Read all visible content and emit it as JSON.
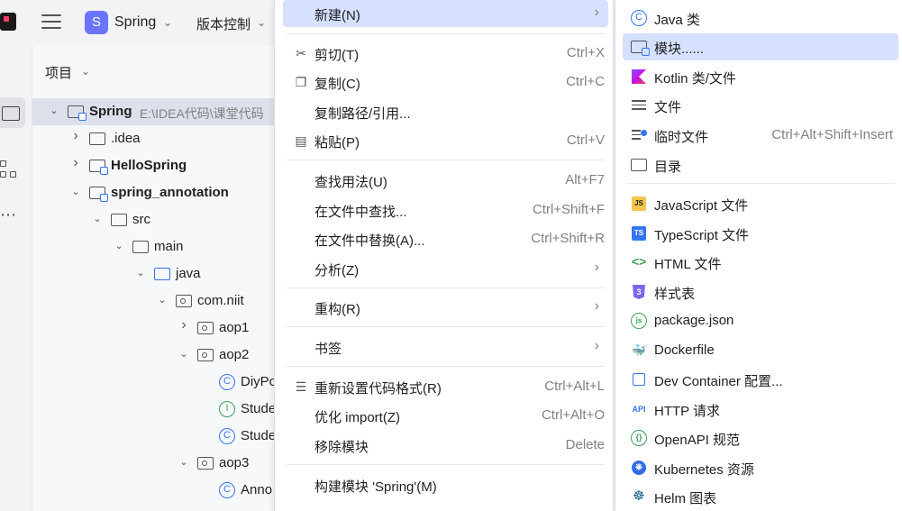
{
  "topbar": {
    "project_badge": "S",
    "project_name": "Spring",
    "vcs_label": "版本控制"
  },
  "panel": {
    "title": "项目",
    "tree": [
      {
        "label": "Spring",
        "path": "E:\\IDEA代码\\课堂代码",
        "icon": "module",
        "bold": true,
        "arrow": "down",
        "selected": true
      },
      {
        "label": ".idea",
        "icon": "folder",
        "arrow": "right"
      },
      {
        "label": "HelloSpring",
        "icon": "module",
        "bold": true,
        "arrow": "right"
      },
      {
        "label": "spring_annotation",
        "icon": "module",
        "bold": true,
        "arrow": "down"
      },
      {
        "label": "src",
        "icon": "folder",
        "arrow": "down"
      },
      {
        "label": "main",
        "icon": "folder",
        "arrow": "down"
      },
      {
        "label": "java",
        "icon": "folder-blue",
        "arrow": "down"
      },
      {
        "label": "com.niit",
        "icon": "package",
        "arrow": "down"
      },
      {
        "label": "aop1",
        "icon": "package",
        "arrow": "right"
      },
      {
        "label": "aop2",
        "icon": "package",
        "arrow": "down"
      },
      {
        "label": "DiyPo",
        "icon": "class",
        "arrow": ""
      },
      {
        "label": "Stude",
        "icon": "interface",
        "arrow": ""
      },
      {
        "label": "Stude",
        "icon": "class",
        "arrow": ""
      },
      {
        "label": "aop3",
        "icon": "package",
        "arrow": "down"
      },
      {
        "label": "Anno",
        "icon": "class",
        "arrow": ""
      }
    ]
  },
  "context_menu": {
    "items": [
      {
        "label": "新建(N)",
        "shortcut": "",
        "submenu": true,
        "icon": "",
        "highlighted": true
      },
      {
        "label": "剪切(T)",
        "shortcut": "Ctrl+X",
        "icon": "scissors-icon"
      },
      {
        "label": "复制(C)",
        "shortcut": "Ctrl+C",
        "icon": "copy-icon"
      },
      {
        "label": "复制路径/引用...",
        "shortcut": "",
        "icon": ""
      },
      {
        "label": "粘贴(P)",
        "shortcut": "Ctrl+V",
        "icon": "paste-icon"
      },
      {
        "label": "查找用法(U)",
        "shortcut": "Alt+F7",
        "icon": ""
      },
      {
        "label": "在文件中查找...",
        "shortcut": "Ctrl+Shift+F",
        "icon": ""
      },
      {
        "label": "在文件中替换(A)...",
        "shortcut": "Ctrl+Shift+R",
        "icon": ""
      },
      {
        "label": "分析(Z)",
        "shortcut": "",
        "submenu": true,
        "icon": ""
      },
      {
        "label": "重构(R)",
        "shortcut": "",
        "submenu": true,
        "icon": ""
      },
      {
        "label": "书签",
        "shortcut": "",
        "submenu": true,
        "icon": ""
      },
      {
        "label": "重新设置代码格式(R)",
        "shortcut": "Ctrl+Alt+L",
        "icon": "reformat-icon"
      },
      {
        "label": "优化 import(Z)",
        "shortcut": "Ctrl+Alt+O",
        "icon": ""
      },
      {
        "label": "移除模块",
        "shortcut": "Delete",
        "icon": ""
      },
      {
        "label": "构建模块 'Spring'(M)",
        "shortcut": "",
        "icon": ""
      }
    ]
  },
  "submenu": {
    "items": [
      {
        "label": "Java 类",
        "shortcut": "",
        "icon": "java-class-icon"
      },
      {
        "label": "模块......",
        "shortcut": "",
        "icon": "module-icon",
        "highlighted": true
      },
      {
        "label": "Kotlin 类/文件",
        "shortcut": "",
        "icon": "kotlin-icon"
      },
      {
        "label": "文件",
        "shortcut": "",
        "icon": "text-file-icon"
      },
      {
        "label": "临时文件",
        "shortcut": "Ctrl+Alt+Shift+Insert",
        "icon": "scratch-file-icon"
      },
      {
        "label": "目录",
        "shortcut": "",
        "icon": "directory-icon"
      },
      {
        "label": "JavaScript 文件",
        "shortcut": "",
        "icon": "javascript-icon"
      },
      {
        "label": "TypeScript 文件",
        "shortcut": "",
        "icon": "typescript-icon"
      },
      {
        "label": "HTML 文件",
        "shortcut": "",
        "icon": "html-icon"
      },
      {
        "label": "样式表",
        "shortcut": "",
        "icon": "css-icon"
      },
      {
        "label": "package.json",
        "shortcut": "",
        "icon": "nodejs-icon"
      },
      {
        "label": "Dockerfile",
        "shortcut": "",
        "icon": "docker-icon"
      },
      {
        "label": "Dev Container 配置...",
        "shortcut": "",
        "icon": "dev-container-icon"
      },
      {
        "label": "HTTP 请求",
        "shortcut": "",
        "icon": "api-icon"
      },
      {
        "label": "OpenAPI 规范",
        "shortcut": "",
        "icon": "openapi-icon"
      },
      {
        "label": "Kubernetes 资源",
        "shortcut": "",
        "icon": "kubernetes-icon"
      },
      {
        "label": "Helm 图表",
        "shortcut": "",
        "icon": "helm-icon"
      }
    ]
  },
  "colors": {
    "accent": "#3574f0",
    "highlight": "#d5e1ff",
    "selection": "#dbe0ea",
    "badge": "#6b74ff"
  }
}
